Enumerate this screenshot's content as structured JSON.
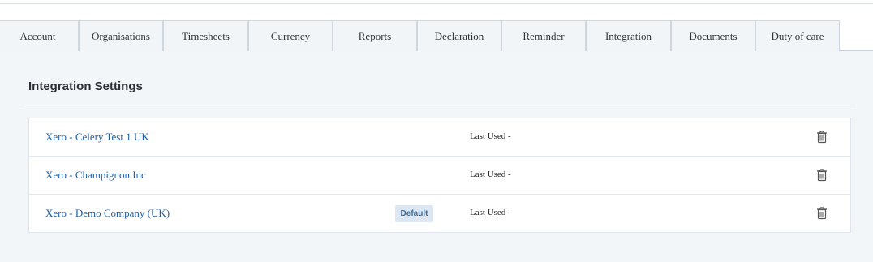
{
  "tabs": [
    {
      "label": "Account"
    },
    {
      "label": "Organisations"
    },
    {
      "label": "Timesheets"
    },
    {
      "label": "Currency"
    },
    {
      "label": "Reports"
    },
    {
      "label": "Declaration"
    },
    {
      "label": "Reminder"
    },
    {
      "label": "Integration",
      "active": true
    },
    {
      "label": "Documents"
    },
    {
      "label": "Duty of care"
    }
  ],
  "section": {
    "title": "Integration Settings"
  },
  "integrations": [
    {
      "name": "Xero - Celery Test 1 UK",
      "last_used": "Last Used -",
      "badge": ""
    },
    {
      "name": "Xero - Champignon Inc",
      "last_used": "Last Used -",
      "badge": ""
    },
    {
      "name": "Xero - Demo Company (UK)",
      "last_used": "Last Used -",
      "badge": "Default"
    }
  ],
  "icons": {
    "delete": "trash-icon"
  },
  "colors": {
    "link": "#1f5fa6",
    "badge_bg": "#dde7f3",
    "page_bg": "#f3f6f9"
  }
}
